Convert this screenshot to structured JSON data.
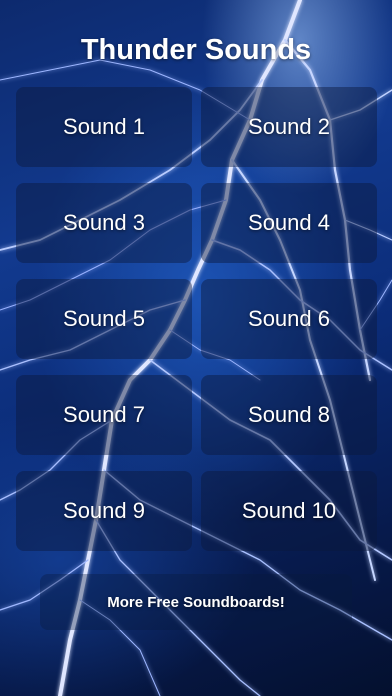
{
  "app": {
    "title": "Thunder Sounds"
  },
  "sounds": [
    {
      "label": "Sound 1"
    },
    {
      "label": "Sound 2"
    },
    {
      "label": "Sound 3"
    },
    {
      "label": "Sound 4"
    },
    {
      "label": "Sound 5"
    },
    {
      "label": "Sound 6"
    },
    {
      "label": "Sound 7"
    },
    {
      "label": "Sound 8"
    },
    {
      "label": "Sound 9"
    },
    {
      "label": "Sound 10"
    }
  ],
  "footer": {
    "more_label": "More Free Soundboards!"
  },
  "theme": {
    "background": "#0d2a6e",
    "button_bg": "rgba(10,25,60,0.45)",
    "text": "#ffffff"
  },
  "background_image": {
    "icon": "lightning-background"
  }
}
